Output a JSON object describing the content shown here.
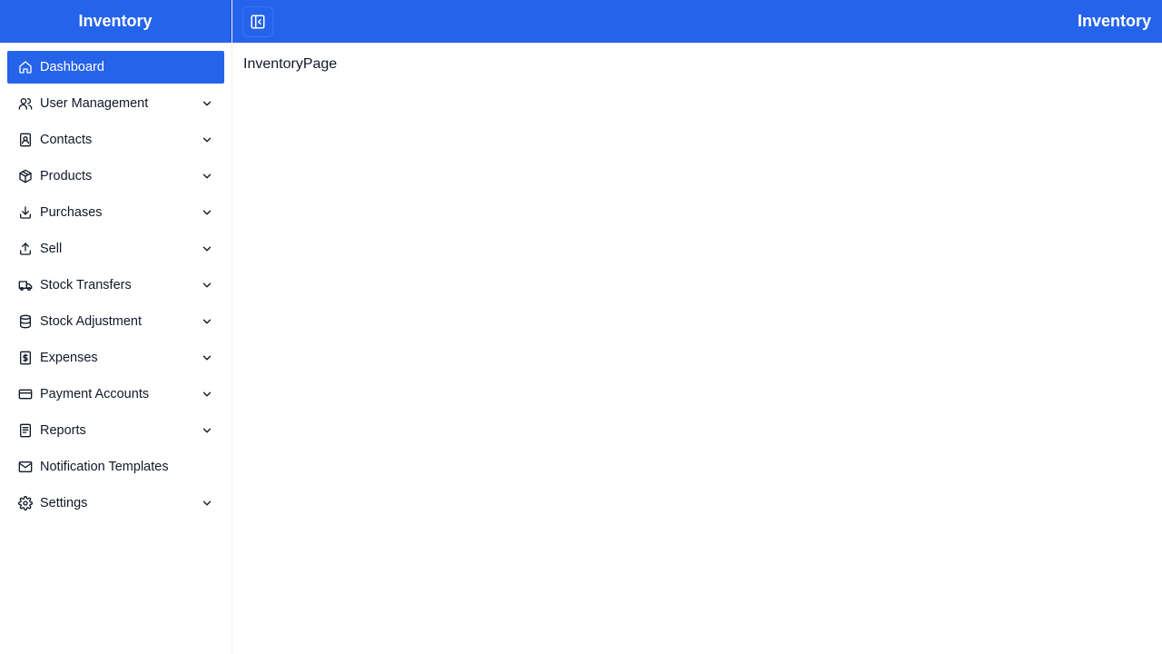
{
  "brand": {
    "title": "Inventory"
  },
  "topbar": {
    "title": "Inventory",
    "toggle_icon": "sidebar-collapse-icon"
  },
  "main": {
    "text": "InventoryPage"
  },
  "colors": {
    "primary": "#2563eb",
    "text": "#111827"
  },
  "sidebar": {
    "items": [
      {
        "label": "Dashboard",
        "icon": "home-icon",
        "active": true,
        "expandable": false
      },
      {
        "label": "User Management",
        "icon": "users-icon",
        "expandable": true
      },
      {
        "label": "Contacts",
        "icon": "contact-book-icon",
        "expandable": true
      },
      {
        "label": "Products",
        "icon": "package-icon",
        "expandable": true
      },
      {
        "label": "Purchases",
        "icon": "download-icon",
        "expandable": true
      },
      {
        "label": "Sell",
        "icon": "upload-icon",
        "expandable": true
      },
      {
        "label": "Stock Transfers",
        "icon": "truck-icon",
        "expandable": true
      },
      {
        "label": "Stock Adjustment",
        "icon": "database-icon",
        "expandable": true
      },
      {
        "label": "Expenses",
        "icon": "dollar-receipt-icon",
        "expandable": true
      },
      {
        "label": "Payment Accounts",
        "icon": "credit-card-icon",
        "expandable": true
      },
      {
        "label": "Reports",
        "icon": "book-icon",
        "expandable": true
      },
      {
        "label": "Notification Templates",
        "icon": "mail-icon",
        "expandable": false
      },
      {
        "label": "Settings",
        "icon": "gear-icon",
        "expandable": true
      }
    ]
  }
}
